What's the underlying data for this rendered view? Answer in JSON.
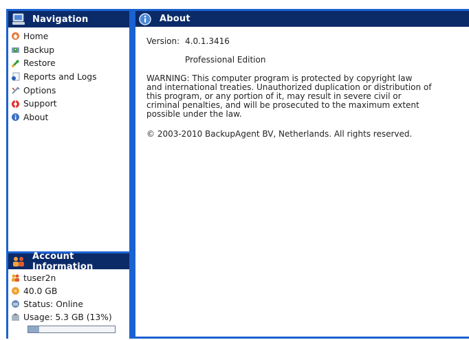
{
  "navigation": {
    "title": "Navigation",
    "items": [
      {
        "label": "Home",
        "icon": "home-icon"
      },
      {
        "label": "Backup",
        "icon": "backup-icon"
      },
      {
        "label": "Restore",
        "icon": "restore-icon"
      },
      {
        "label": "Reports and Logs",
        "icon": "reports-icon"
      },
      {
        "label": "Options",
        "icon": "options-icon"
      },
      {
        "label": "Support",
        "icon": "support-icon"
      },
      {
        "label": "About",
        "icon": "info-icon"
      }
    ]
  },
  "account": {
    "title": "Account Information",
    "username": "tuser2n",
    "quota": "40.0 GB",
    "status": "Status: Online",
    "usage": "Usage: 5.3 GB (13%)",
    "usage_fraction": 0.13
  },
  "about": {
    "title": "About",
    "version_label": "Version:",
    "version_value": "4.0.1.3416",
    "edition": "Professional Edition",
    "warning_lines": [
      "WARNING: This computer program is protected by copyright law",
      "and international treaties. Unauthorized duplication or distribution of",
      "this program, or any portion of it, may result in severe civil or",
      "criminal penalties, and will be prosecuted to the maximum extent",
      "possible under the law."
    ],
    "copyright": "© 2003-2010 BackupAgent BV, Netherlands. All rights reserved."
  },
  "colors": {
    "frame": "#1a62d2",
    "header": "#0b2a68"
  }
}
